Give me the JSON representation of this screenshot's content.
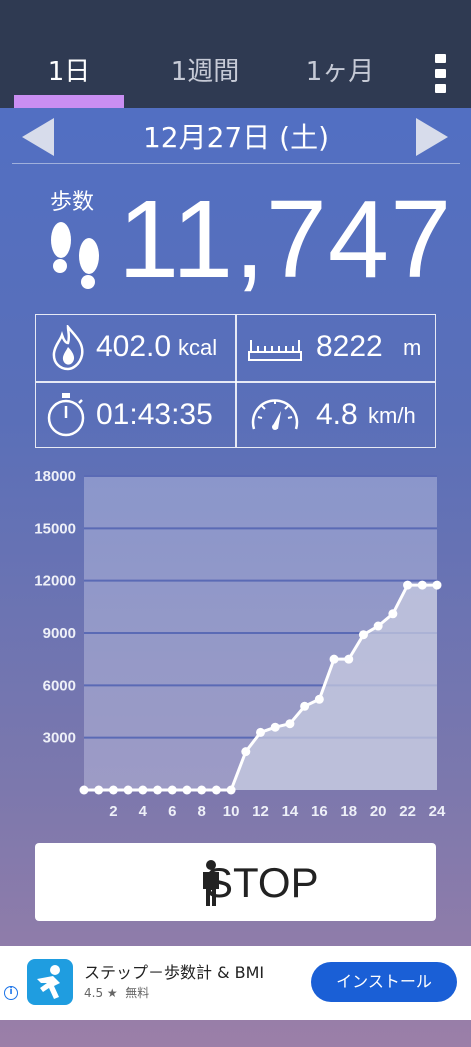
{
  "tabs": [
    {
      "label": "1日",
      "active": true
    },
    {
      "label": "1週間",
      "active": false
    },
    {
      "label": "1ヶ月",
      "active": false
    }
  ],
  "date": "12月27日 (土)",
  "steps": {
    "label": "歩数",
    "value": "11,747"
  },
  "stats": {
    "calories": {
      "value": "402.0",
      "unit": "kcal"
    },
    "distance": {
      "value": "8222",
      "unit": "m"
    },
    "time": {
      "value": "01:43:35"
    },
    "speed": {
      "value": "4.8",
      "unit": "km/h"
    }
  },
  "chart_data": {
    "type": "area",
    "xlim": [
      0,
      24
    ],
    "ylim": [
      0,
      18000
    ],
    "y_ticks": [
      "3000",
      "6000",
      "9000",
      "12000",
      "15000",
      "18000"
    ],
    "x_ticks": [
      "2",
      "4",
      "6",
      "8",
      "10",
      "12",
      "14",
      "16",
      "18",
      "20",
      "22",
      "24"
    ],
    "grid": true,
    "x": [
      0,
      1,
      2,
      3,
      4,
      5,
      6,
      7,
      8,
      9,
      10,
      11,
      12,
      13,
      14,
      15,
      16,
      17,
      18,
      19,
      20,
      21,
      22,
      23,
      24
    ],
    "values": [
      0,
      0,
      0,
      0,
      0,
      0,
      0,
      0,
      0,
      0,
      0,
      2200,
      3300,
      3600,
      3800,
      4800,
      5200,
      7500,
      7500,
      8900,
      9400,
      10100,
      11747,
      11747,
      11747
    ],
    "colors": {
      "fill": "#c7cbe0",
      "line": "#ffffff",
      "grid": "#5a6ab5"
    }
  },
  "stop_button": {
    "label": "STOP"
  },
  "ad": {
    "title": "ステップ－歩数計 & BMI",
    "rating": "4.5 ★",
    "price": "無料",
    "install_label": "インストール",
    "info_icon": "i"
  }
}
